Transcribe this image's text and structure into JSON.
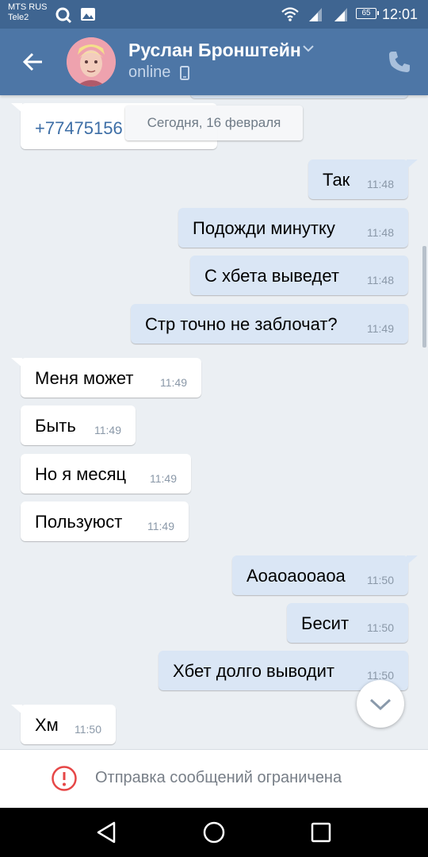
{
  "status_bar": {
    "carrier_1": "MTS RUS",
    "carrier_2": "Tele2",
    "battery": "65",
    "time": "12:01"
  },
  "header": {
    "name": "Руслан Бронштейн",
    "status": "online"
  },
  "chat": {
    "partial_first": "+77475156",
    "date_separator": "Сегодня, 16 февраля",
    "messages": [
      {
        "dir": "out",
        "text": "Так",
        "time": "11:48"
      },
      {
        "dir": "out",
        "text": "Подожди минутку",
        "time": "11:48"
      },
      {
        "dir": "out",
        "text": "С хбета выведет",
        "time": "11:48"
      },
      {
        "dir": "out",
        "text": "Стр точно не заблочат?",
        "time": "11:49"
      },
      {
        "dir": "in",
        "text": "Меня может",
        "time": "11:49"
      },
      {
        "dir": "in",
        "text": "Быть",
        "time": "11:49"
      },
      {
        "dir": "in",
        "text": "Но я месяц",
        "time": "11:49"
      },
      {
        "dir": "in",
        "text": "Пользуюст",
        "time": "11:49"
      },
      {
        "dir": "out",
        "text": "Аоаоаоoаоа",
        "time": "11:50"
      },
      {
        "dir": "out",
        "text": "Бесит",
        "time": "11:50"
      },
      {
        "dir": "out",
        "text": "Хбет долго выводит",
        "time": "11:50"
      },
      {
        "dir": "in",
        "text": "Хм",
        "time": "11:50"
      }
    ]
  },
  "restriction": {
    "text": "Отправка сообщений ограничена"
  },
  "colors": {
    "header": "#4d76a6",
    "status_bar": "#3f6591",
    "chat_bg": "#ebeff3",
    "outgoing_bubble": "#dae6f5",
    "incoming_bubble": "#ffffff",
    "restriction_icon": "#e64646"
  },
  "icons": {
    "back": "arrow-left-icon",
    "call": "phone-icon",
    "status_mobile": "mobile-phone-icon",
    "scroll_down": "chevron-down-icon",
    "restriction": "exclamation-circle-icon",
    "nav": [
      "back-triangle-icon",
      "home-circle-icon",
      "recents-square-icon"
    ]
  }
}
